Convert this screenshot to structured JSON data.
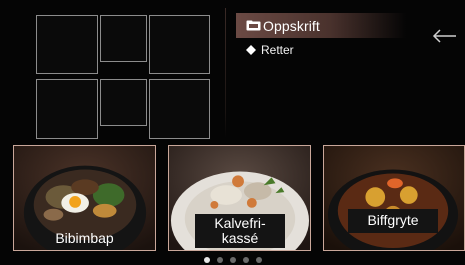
{
  "menu": {
    "primary": {
      "label": "Oppskrift",
      "icon": "folder-icon"
    },
    "secondary": {
      "label": "Retter",
      "icon": "diamond-icon"
    },
    "back_icon": "arrow-left-icon"
  },
  "cards": [
    {
      "label": "Bibimbap"
    },
    {
      "label_line1": "Kalvefri-",
      "label_line2": "kassé"
    },
    {
      "label": "Biffgryte"
    }
  ],
  "pagination": {
    "total": 5,
    "active": 1
  },
  "colors": {
    "card_border": "#c9a79a",
    "menu_highlight": "#6b4a44",
    "placeholder_border": "#8c8c8c"
  }
}
